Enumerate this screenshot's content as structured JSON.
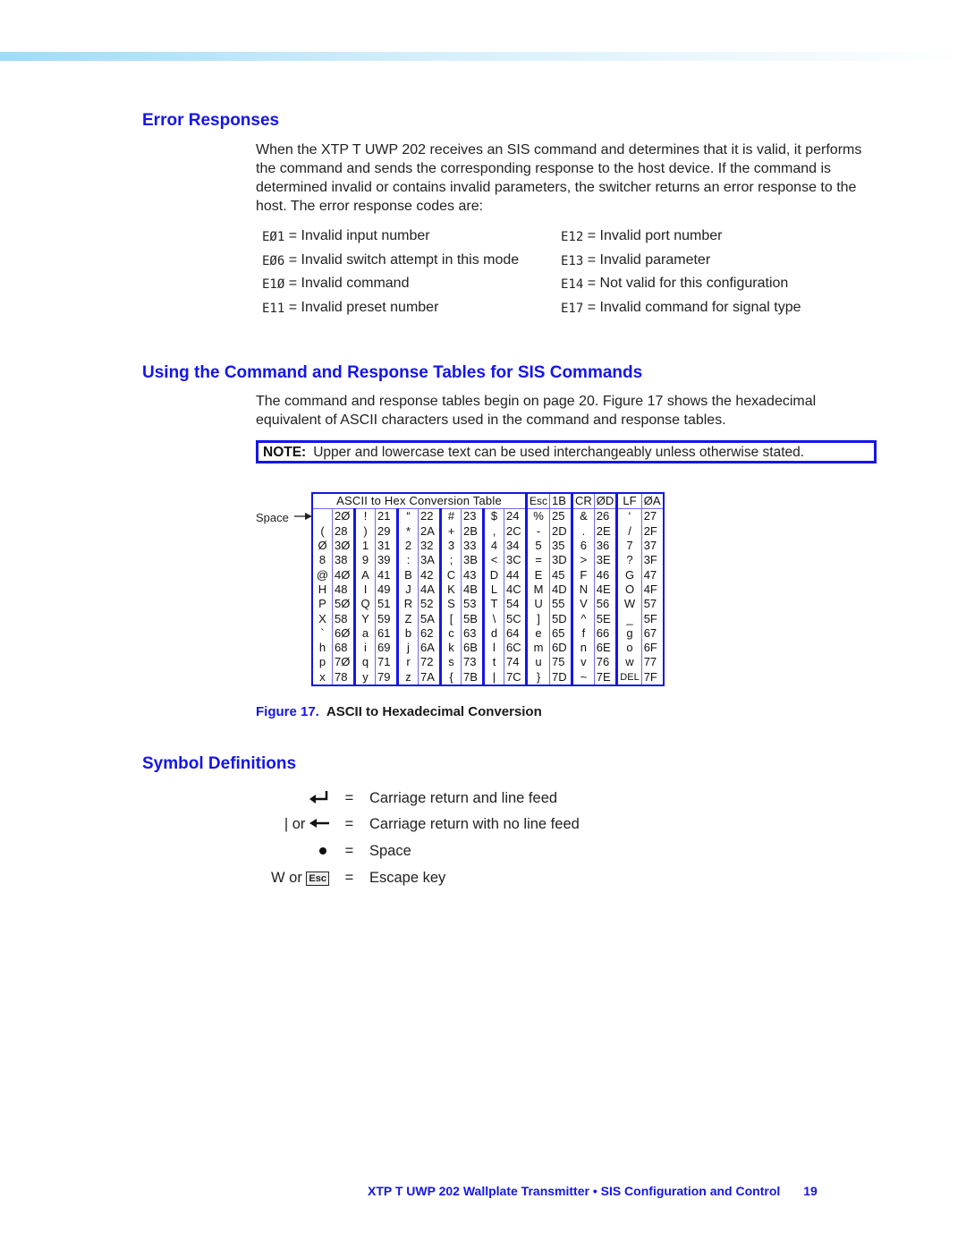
{
  "sections": {
    "error_responses": {
      "heading": "Error Responses",
      "intro": "When the XTP T UWP 202 receives an SIS command and determines that it is valid, it performs the command and sends the corresponding response to the host device. If the command is determined invalid or contains invalid parameters, the switcher returns an error response to the host. The error response codes are:",
      "codes_left": [
        {
          "code": "EØ1",
          "desc": " = Invalid input number"
        },
        {
          "code": "EØ6",
          "desc": " = Invalid switch attempt in this mode"
        },
        {
          "code": "E1Ø",
          "desc": " = Invalid command"
        },
        {
          "code": "E11",
          "desc": " = Invalid preset number"
        }
      ],
      "codes_right": [
        {
          "code": "E12",
          "desc": " = Invalid port number"
        },
        {
          "code": "E13",
          "desc": " = Invalid parameter"
        },
        {
          "code": "E14",
          "desc": " = Not valid for this configuration"
        },
        {
          "code": "E17",
          "desc": " = Invalid command for signal type"
        }
      ]
    },
    "command_tables": {
      "heading": "Using the Command and Response Tables for SIS Commands",
      "intro": "The command and response tables begin on page 20. Figure 17 shows the hexadecimal equivalent of ASCII characters used in the command and response tables.",
      "note_label": "NOTE:",
      "note_text": "Upper and lowercase text can be used interchangeably unless otherwise stated."
    },
    "figure": {
      "space_label": "Space",
      "table_title": "ASCII to Hex Conversion Table",
      "header_pairs": [
        [
          "Esc",
          "1B"
        ],
        [
          "CR",
          "ØD"
        ],
        [
          "LF",
          "ØA"
        ]
      ],
      "rows": [
        [
          [
            "",
            "2Ø"
          ],
          [
            "!",
            "21"
          ],
          [
            "“",
            "22"
          ],
          [
            "#",
            "23"
          ],
          [
            "$",
            "24"
          ],
          [
            "%",
            "25"
          ],
          [
            "&",
            "26"
          ],
          [
            "‘",
            "27"
          ]
        ],
        [
          [
            "(",
            "28"
          ],
          [
            ")",
            "29"
          ],
          [
            "*",
            "2A"
          ],
          [
            "+",
            "2B"
          ],
          [
            ",",
            "2C"
          ],
          [
            "-",
            "2D"
          ],
          [
            ".",
            "2E"
          ],
          [
            "/",
            "2F"
          ]
        ],
        [
          [
            "Ø",
            "3Ø"
          ],
          [
            "1",
            "31"
          ],
          [
            "2",
            "32"
          ],
          [
            "3",
            "33"
          ],
          [
            "4",
            "34"
          ],
          [
            "5",
            "35"
          ],
          [
            "6",
            "36"
          ],
          [
            "7",
            "37"
          ]
        ],
        [
          [
            "8",
            "38"
          ],
          [
            "9",
            "39"
          ],
          [
            ":",
            "3A"
          ],
          [
            ";",
            "3B"
          ],
          [
            "<",
            "3C"
          ],
          [
            "=",
            "3D"
          ],
          [
            ">",
            "3E"
          ],
          [
            "?",
            "3F"
          ]
        ],
        [
          [
            "@",
            "4Ø"
          ],
          [
            "A",
            "41"
          ],
          [
            "B",
            "42"
          ],
          [
            "C",
            "43"
          ],
          [
            "D",
            "44"
          ],
          [
            "E",
            "45"
          ],
          [
            "F",
            "46"
          ],
          [
            "G",
            "47"
          ]
        ],
        [
          [
            "H",
            "48"
          ],
          [
            "I",
            "49"
          ],
          [
            "J",
            "4A"
          ],
          [
            "K",
            "4B"
          ],
          [
            "L",
            "4C"
          ],
          [
            "M",
            "4D"
          ],
          [
            "N",
            "4E"
          ],
          [
            "O",
            "4F"
          ]
        ],
        [
          [
            "P",
            "5Ø"
          ],
          [
            "Q",
            "51"
          ],
          [
            "R",
            "52"
          ],
          [
            "S",
            "53"
          ],
          [
            "T",
            "54"
          ],
          [
            "U",
            "55"
          ],
          [
            "V",
            "56"
          ],
          [
            "W",
            "57"
          ]
        ],
        [
          [
            "X",
            "58"
          ],
          [
            "Y",
            "59"
          ],
          [
            "Z",
            "5A"
          ],
          [
            "[",
            "5B"
          ],
          [
            "\\",
            "5C"
          ],
          [
            "]",
            "5D"
          ],
          [
            "^",
            "5E"
          ],
          [
            "_",
            "5F"
          ]
        ],
        [
          [
            "`",
            "6Ø"
          ],
          [
            "a",
            "61"
          ],
          [
            "b",
            "62"
          ],
          [
            "c",
            "63"
          ],
          [
            "d",
            "64"
          ],
          [
            "e",
            "65"
          ],
          [
            "f",
            "66"
          ],
          [
            "g",
            "67"
          ]
        ],
        [
          [
            "h",
            "68"
          ],
          [
            "i",
            "69"
          ],
          [
            "j",
            "6A"
          ],
          [
            "k",
            "6B"
          ],
          [
            "l",
            "6C"
          ],
          [
            "m",
            "6D"
          ],
          [
            "n",
            "6E"
          ],
          [
            "o",
            "6F"
          ]
        ],
        [
          [
            "p",
            "7Ø"
          ],
          [
            "q",
            "71"
          ],
          [
            "r",
            "72"
          ],
          [
            "s",
            "73"
          ],
          [
            "t",
            "74"
          ],
          [
            "u",
            "75"
          ],
          [
            "v",
            "76"
          ],
          [
            "w",
            "77"
          ]
        ],
        [
          [
            "x",
            "78"
          ],
          [
            "y",
            "79"
          ],
          [
            "z",
            "7A"
          ],
          [
            "{",
            "7B"
          ],
          [
            "|",
            "7C"
          ],
          [
            "}",
            "7D"
          ],
          [
            "~",
            "7E"
          ],
          [
            "DEL",
            "7F"
          ]
        ]
      ],
      "caption_number": "Figure 17.",
      "caption_text": "ASCII to Hexadecimal Conversion"
    },
    "symbols": {
      "heading": "Symbol Definitions",
      "items": [
        {
          "icon": "carriage-return-line-feed-icon",
          "prefix": "",
          "eq": "=",
          "desc": "Carriage return and line feed"
        },
        {
          "icon": "carriage-return-no-line-feed-icon",
          "prefix": "| or",
          "eq": "=",
          "desc": "Carriage return with no line feed"
        },
        {
          "icon": "space-dot-icon",
          "prefix": "",
          "eq": "=",
          "desc": "Space"
        },
        {
          "icon": "escape-key-icon",
          "prefix": "W or",
          "key_label": "Esc",
          "eq": "=",
          "desc": "Escape key"
        }
      ]
    }
  },
  "footer": {
    "title": "XTP T UWP 202 Wallplate Transmitter • SIS Configuration and Control",
    "page_number": "19"
  },
  "colors": {
    "accent": "#1515e8",
    "topbar": "#9fdcf7"
  }
}
